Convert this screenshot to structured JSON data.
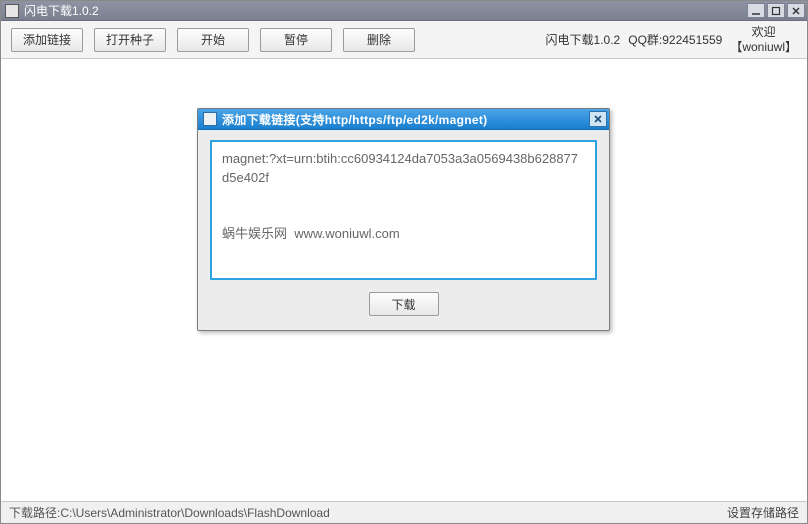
{
  "window": {
    "title": "闪电下载1.0.2"
  },
  "toolbar": {
    "buttons": {
      "add_link": "添加链接",
      "open_seed": "打开种子",
      "start": "开始",
      "pause": "暂停",
      "delete": "删除"
    },
    "info_version": "闪电下载1.0.2",
    "info_qq": "QQ群:922451559",
    "welcome_line1": "欢迎",
    "welcome_line2": "【woniuwl】"
  },
  "dialog": {
    "title": "添加下载链接(支持http/https/ftp/ed2k/magnet)",
    "textarea_value": "magnet:?xt=urn:btih:cc60934124da7053a3a0569438b628877d5e402f\n\n\n蜗牛娱乐网  www.woniuwl.com",
    "download_label": "下载"
  },
  "statusbar": {
    "path_label": "下载路径:",
    "path_value": "C:\\Users\\Administrator\\Downloads\\FlashDownload",
    "set_path": "设置存储路径"
  }
}
